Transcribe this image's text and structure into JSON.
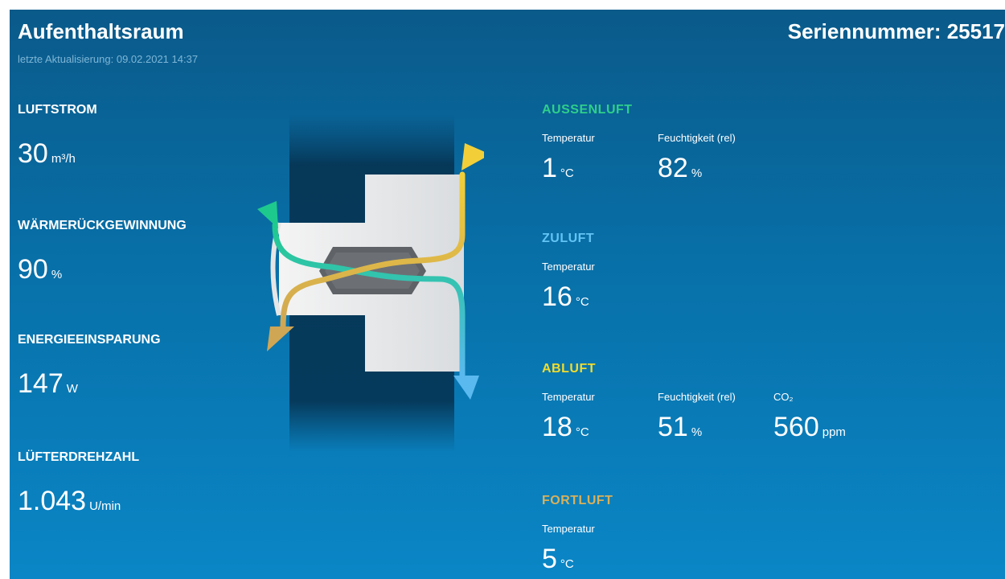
{
  "header": {
    "room_name": "Aufenthaltsraum",
    "serial_label": "Seriennummer: 25517",
    "last_update": "letzte Aktualisierung: 09.02.2021 14:37"
  },
  "stats": {
    "airflow": {
      "label": "LUFTSTROM",
      "value": "30",
      "unit": "m³/h"
    },
    "heat_recovery": {
      "label": "WÄRMERÜCKGEWINNUNG",
      "value": "90",
      "unit": "%"
    },
    "energy_saving": {
      "label": "ENERGIEEINSPARUNG",
      "value": "147",
      "unit": "W"
    },
    "fan_speed": {
      "label": "LÜFTERDREHZAHL",
      "value": "1.043",
      "unit": "U/min"
    }
  },
  "sections": {
    "outdoor_air": {
      "title": "AUSSENLUFT",
      "color": "#2ecf8a",
      "temp_label": "Temperatur",
      "temp_value": "1",
      "temp_unit": "°C",
      "hum_label": "Feuchtigkeit (rel)",
      "hum_value": "82",
      "hum_unit": "%"
    },
    "supply_air": {
      "title": "ZULUFT",
      "color": "#62c4f4",
      "temp_label": "Temperatur",
      "temp_value": "16",
      "temp_unit": "°C"
    },
    "exhaust_air": {
      "title": "ABLUFT",
      "color": "#f3dc2b",
      "temp_label": "Temperatur",
      "temp_value": "18",
      "temp_unit": "°C",
      "hum_label": "Feuchtigkeit (rel)",
      "hum_value": "51",
      "hum_unit": "%",
      "co2_label": "CO₂",
      "co2_value": "560",
      "co2_unit": "ppm"
    },
    "outgoing_air": {
      "title": "FORTLUFT",
      "color": "#d8b05a",
      "temp_label": "Temperatur",
      "temp_value": "5",
      "temp_unit": "°C"
    }
  },
  "diagram_colors": {
    "outdoor": "#1ec98d",
    "supply": "#5ab9ef",
    "exhaust": "#f2cf38",
    "outgoing": "#cfa654"
  }
}
